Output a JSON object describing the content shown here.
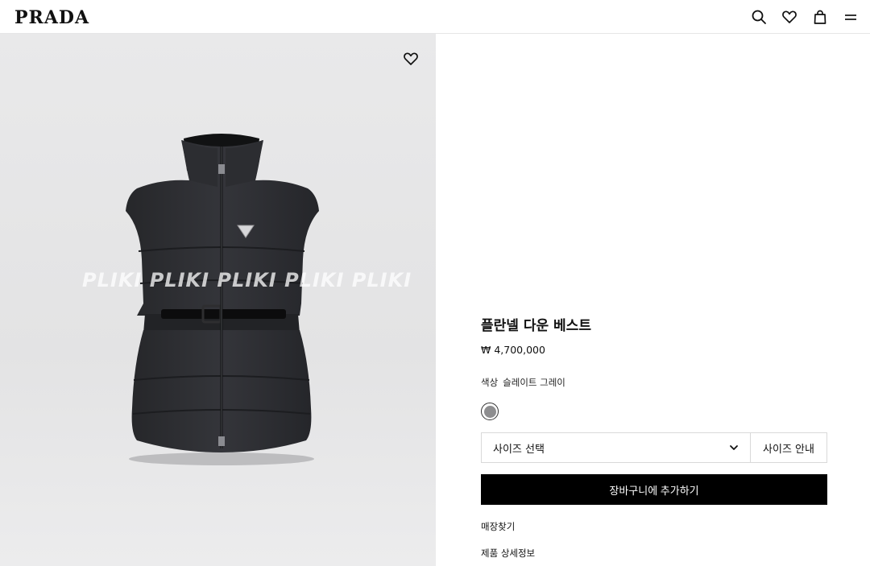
{
  "header": {
    "logo": "PRADA",
    "icons": [
      "search-icon",
      "heart-icon",
      "bag-icon",
      "menu-icon"
    ]
  },
  "image": {
    "watermark": "PLIKI  PLIKI  PLIKI  PLIKI  PLIKI",
    "favorite_icon": "heart-icon"
  },
  "product": {
    "title": "플란넬 다운 베스트",
    "price": "₩ 4,700,000",
    "color_label": "색상",
    "color_value": "슬레이트 그레이",
    "swatch_color": "#8d8d8f",
    "size_select": "사이즈 선택",
    "size_guide": "사이즈 안내",
    "add_to_cart": "장바구니에 추가하기",
    "store_finder": "매장찾기",
    "product_details": "제품 상세정보"
  }
}
